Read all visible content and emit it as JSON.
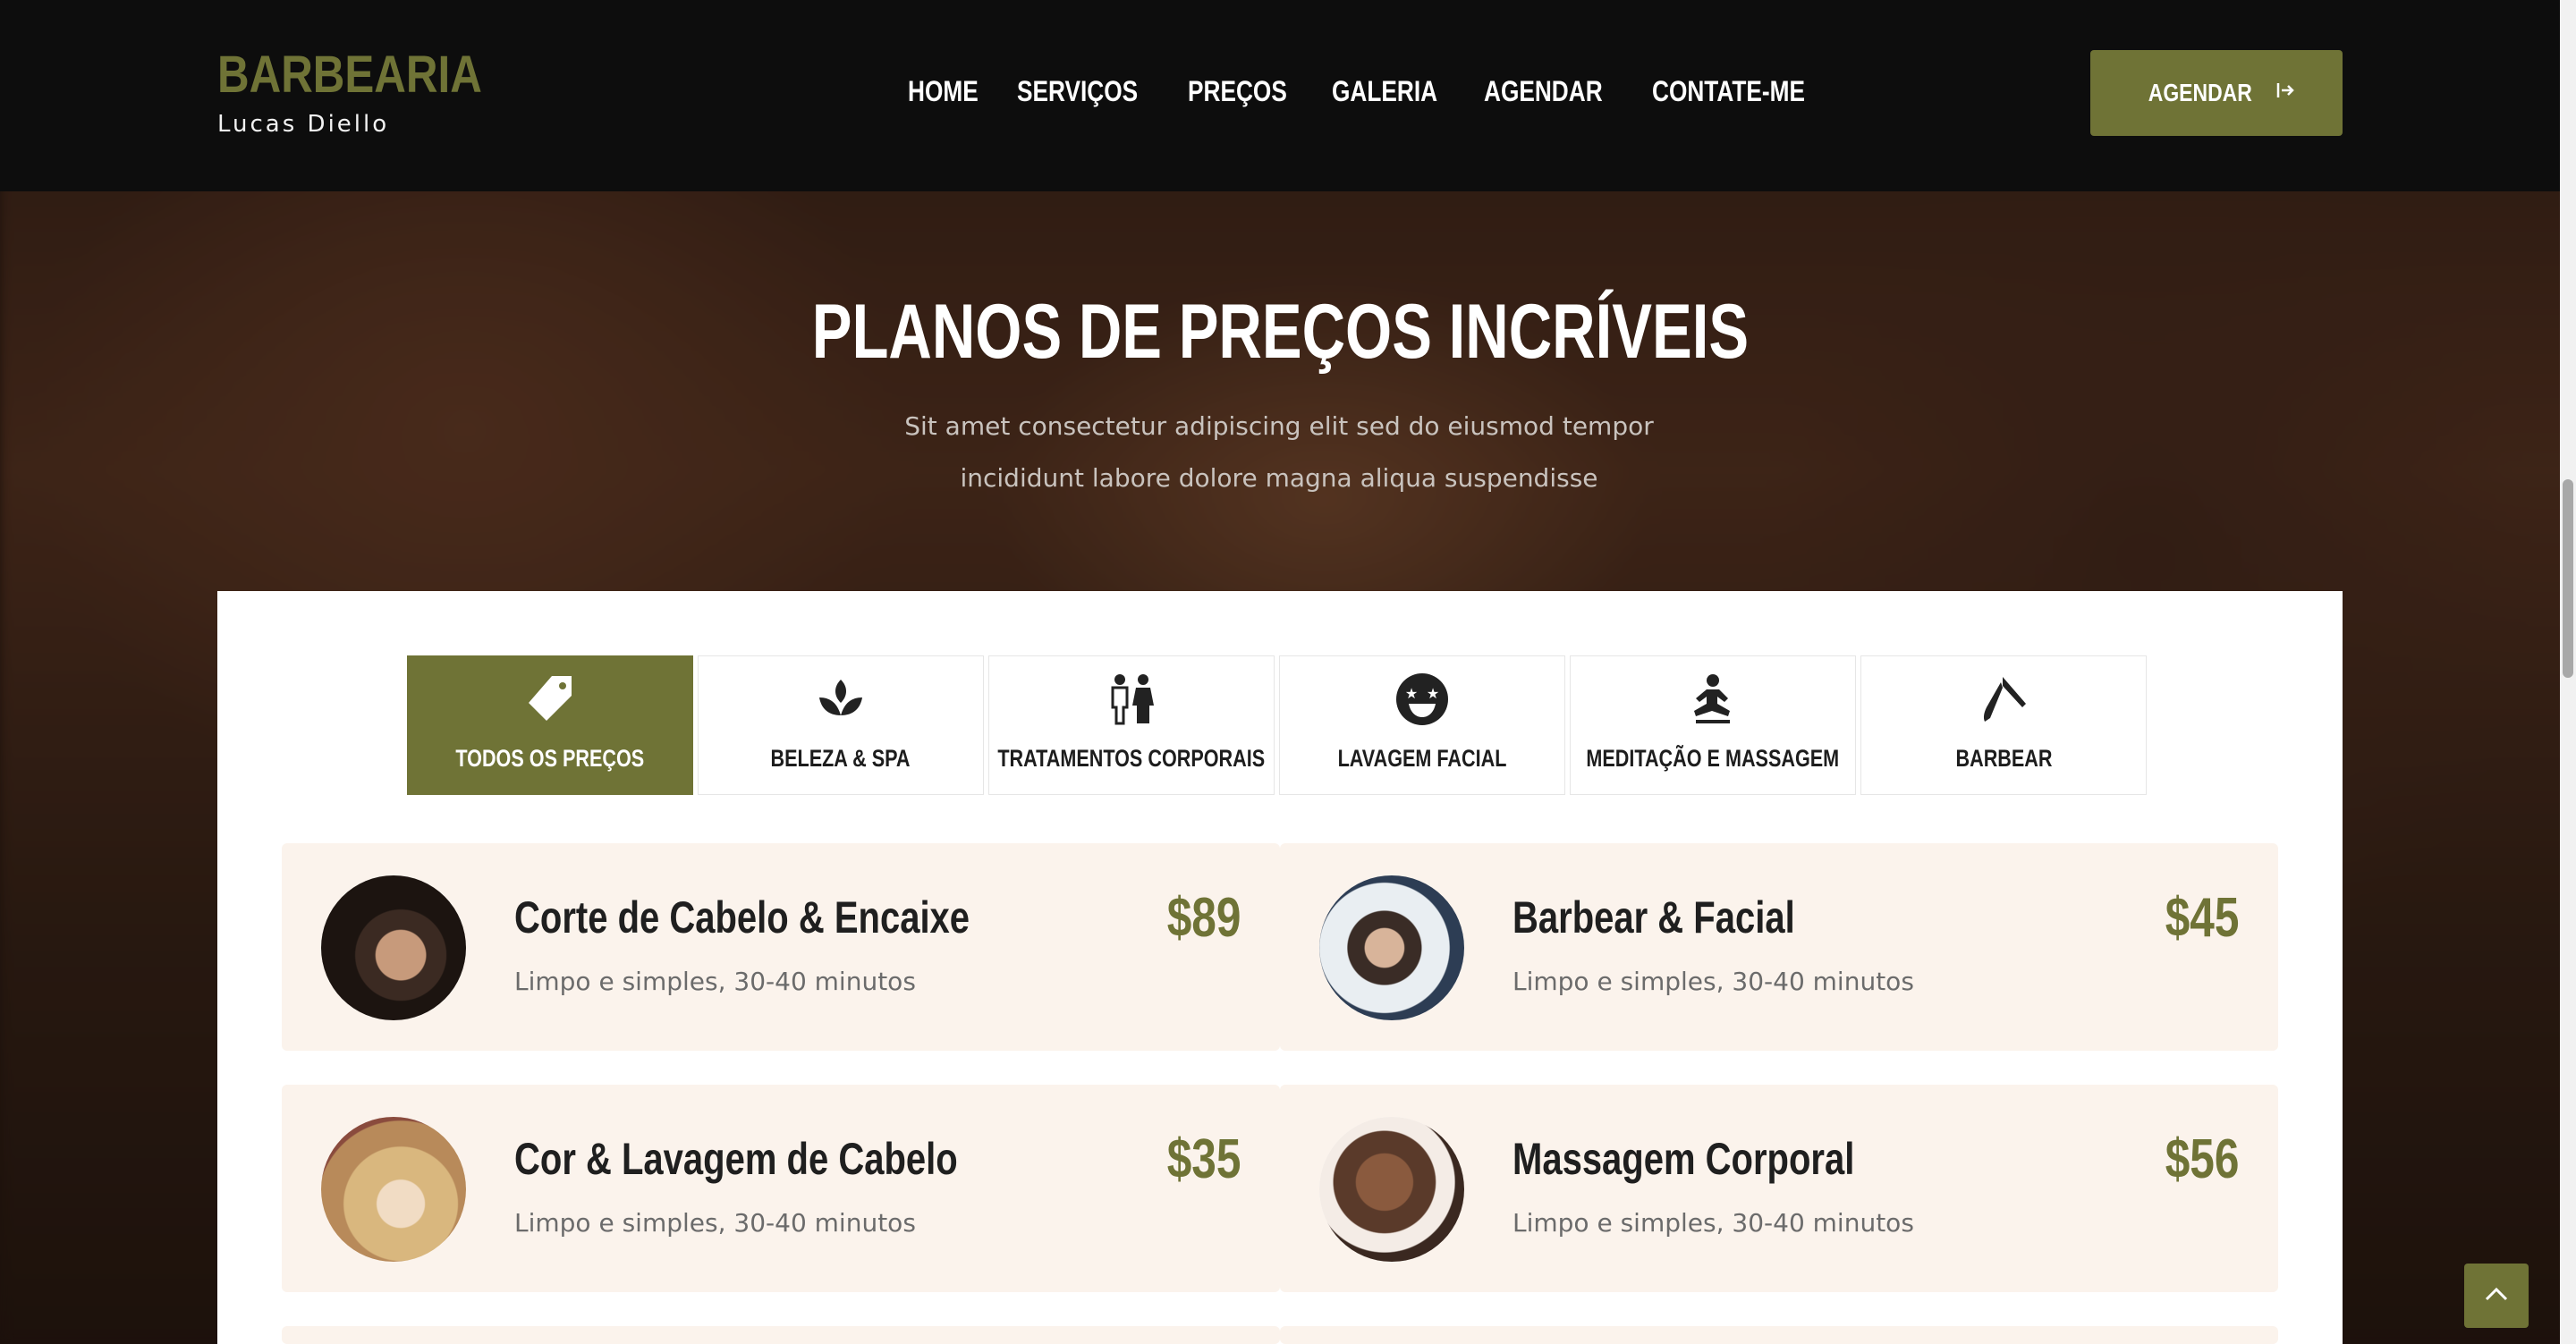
{
  "brand": {
    "title": "BARBEARIA",
    "subtitle": "Lucas Diello"
  },
  "nav": {
    "items": [
      "HOME",
      "SERVIÇOS",
      "PREÇOS",
      "GALERIA",
      "AGENDAR",
      "CONTATE-ME"
    ]
  },
  "cta": {
    "label": "AGENDAR",
    "icon": "arrow-right-to-bracket-icon"
  },
  "hero": {
    "title": "PLANOS DE PREÇOS INCRÍVEIS",
    "subtitle_line1": "Sit amet consectetur adipiscing elit sed do eiusmod tempor",
    "subtitle_line2": "incididunt labore dolore magna aliqua suspendisse"
  },
  "tabs": [
    {
      "label": "TODOS OS PREÇOS",
      "icon": "tag-icon",
      "active": true
    },
    {
      "label": "BELEZA & SPA",
      "icon": "lotus-icon",
      "active": false
    },
    {
      "label": "TRATAMENTOS CORPORAIS",
      "icon": "people-icon",
      "active": false
    },
    {
      "label": "LAVAGEM FACIAL",
      "icon": "star-eyes-face-icon",
      "active": false
    },
    {
      "label": "MEDITAÇÃO E MASSAGEM",
      "icon": "meditation-icon",
      "active": false
    },
    {
      "label": "BARBEAR",
      "icon": "razor-icon",
      "active": false
    }
  ],
  "prices": [
    {
      "title": "Corte de Cabelo & Encaixe",
      "desc": "Limpo e simples, 30-40 minutos",
      "price": "$89"
    },
    {
      "title": "Barbear & Facial",
      "desc": "Limpo e simples, 30-40 minutos",
      "price": "$45"
    },
    {
      "title": "Cor & Lavagem de Cabelo",
      "desc": "Limpo e simples, 30-40 minutos",
      "price": "$35"
    },
    {
      "title": "Massagem Corporal",
      "desc": "Limpo e simples, 30-40 minutos",
      "price": "$56"
    }
  ],
  "colors": {
    "accent": "#6f7336",
    "header_bg": "#0d0d0d",
    "card_bg": "#fbf3ec",
    "price": "#6f7336"
  }
}
